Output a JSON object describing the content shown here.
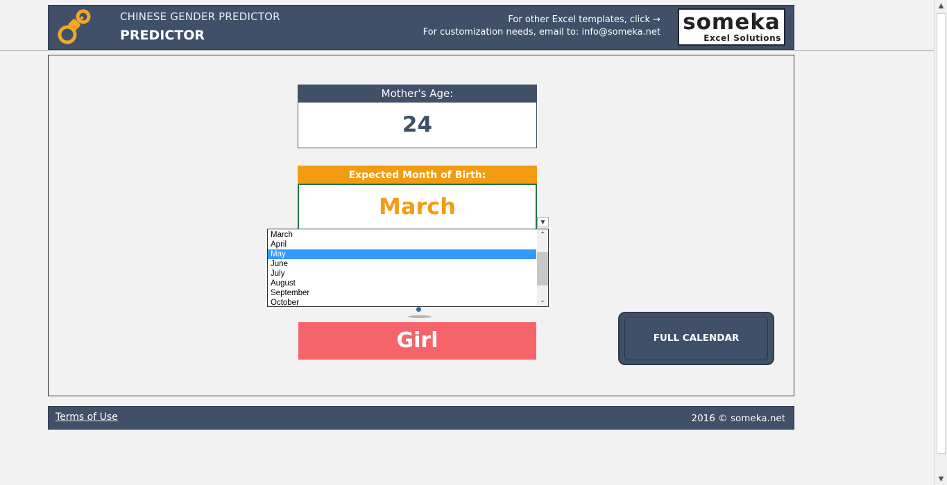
{
  "header": {
    "app_title": "CHINESE GENDER PREDICTOR",
    "page_title": "PREDICTOR",
    "template_link": "For other Excel templates, click →",
    "email_text": "For customization needs, email to: info@someka.net",
    "brand_name": "someka",
    "brand_sub": "Excel Solutions"
  },
  "age": {
    "label": "Mother's Age:",
    "value": "24"
  },
  "month": {
    "label": "Expected Month of Birth:",
    "value": "March",
    "options": [
      "March",
      "April",
      "May",
      "June",
      "July",
      "August",
      "September",
      "October"
    ],
    "highlighted": "May"
  },
  "result": {
    "value": "Girl"
  },
  "buttons": {
    "full_calendar": "FULL CALENDAR"
  },
  "footer": {
    "terms": "Terms of Use",
    "copyright": "2016 © someka.net"
  },
  "icons": {
    "logo": "pacifier-icon",
    "dropdown": "chevron-down-icon",
    "scroll_up": "chevron-up-icon",
    "scroll_down": "chevron-down-icon"
  },
  "colors": {
    "header": "#3f5068",
    "month_accent": "#f39c12",
    "result_girl": "#f4646a",
    "selection": "#3399ff"
  }
}
